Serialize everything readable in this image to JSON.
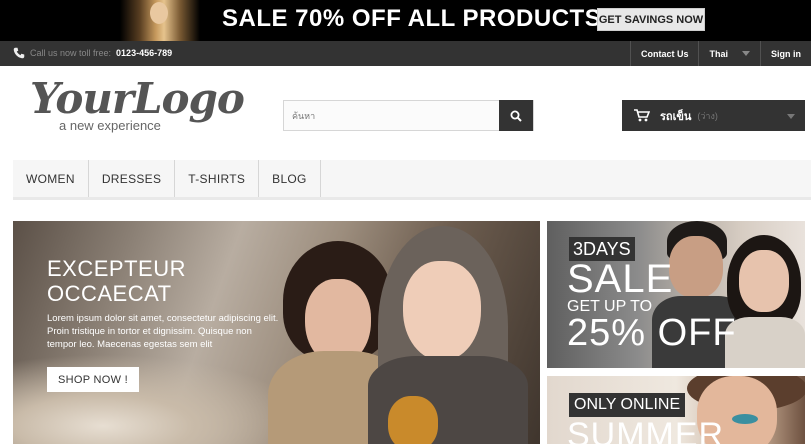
{
  "promo": {
    "headline": "SALE 70% OFF ALL PRODUCTS",
    "cta": "GET SAVINGS NOW"
  },
  "nav": {
    "call_text": "Call us now toll free:",
    "phone": "0123-456-789",
    "contact": "Contact Us",
    "language": "Thai",
    "sign_in": "Sign in"
  },
  "header": {
    "logo_main": "YourLogo",
    "logo_sub": "a new experience",
    "search_placeholder": "ค้นหา",
    "cart_label": "รถเข็น",
    "cart_status": "(ว่าง)"
  },
  "menu": {
    "items": [
      "WOMEN",
      "DRESSES",
      "T-SHIRTS",
      "BLOG"
    ]
  },
  "hero": {
    "title_line1": "EXCEPTEUR",
    "title_line2": "OCCAECAT",
    "description": "Lorem ipsum dolor sit amet, consectetur adipiscing elit. Proin tristique in tortor et dignissim. Quisque non tempor leo. Maecenas egestas sem elit",
    "button": "SHOP NOW !"
  },
  "banner_sale": {
    "tag": "3DAYS",
    "sale": "SALE",
    "up_to": "GET UP TO",
    "percent": "25% OFF"
  },
  "banner_online": {
    "tag": "ONLY ONLINE",
    "title": "SUMMER"
  },
  "icons": {
    "phone": "phone-icon",
    "search": "search-icon",
    "cart": "cart-icon"
  },
  "colors": {
    "dark": "#333333",
    "black": "#000000",
    "menu_bg": "#f6f6f6"
  }
}
